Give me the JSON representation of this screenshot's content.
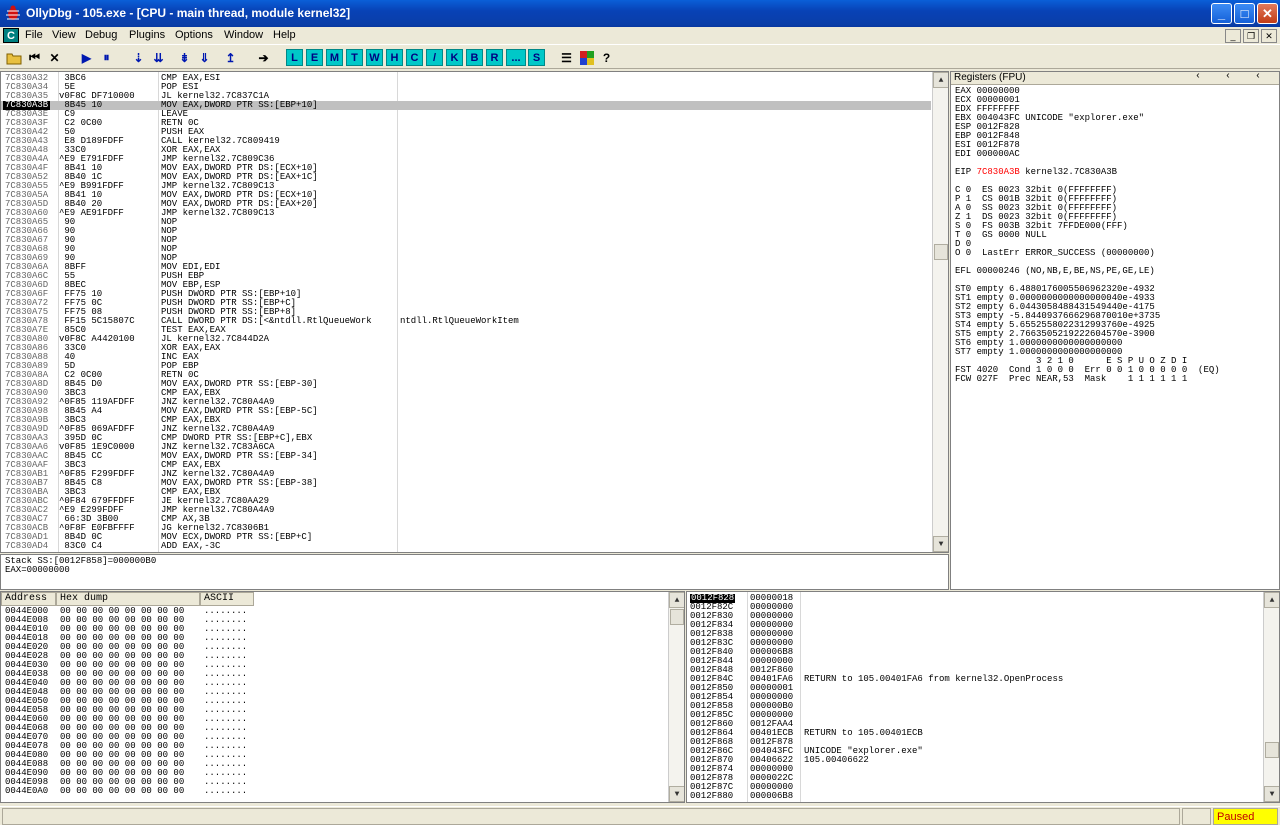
{
  "window": {
    "title": "OllyDbg - 105.exe - [CPU - main thread, module kernel32]",
    "minimize": "_",
    "maximize": "□",
    "close": "✕"
  },
  "menu": {
    "items": [
      "File",
      "View",
      "Debug",
      "Plugins",
      "Options",
      "Window",
      "Help"
    ],
    "c_icon": "C"
  },
  "toolbar": {
    "letters": [
      "L",
      "E",
      "M",
      "T",
      "W",
      "H",
      "C",
      "/",
      "K",
      "B",
      "R",
      "...",
      "S"
    ]
  },
  "disasm": {
    "rows": [
      [
        "7C830A32",
        " 3BC6",
        "CMP EAX,ESI",
        ""
      ],
      [
        "7C830A34",
        " 5E",
        "POP ESI",
        ""
      ],
      [
        "7C830A35",
        "v0F8C DF710000",
        "JL kernel32.7C837C1A",
        ""
      ],
      [
        "7C830A3B",
        " 8B45 10",
        "MOV EAX,DWORD PTR SS:[EBP+10]",
        ""
      ],
      [
        "7C830A3E",
        " C9",
        "LEAVE",
        ""
      ],
      [
        "7C830A3F",
        " C2 0C00",
        "RETN 0C",
        ""
      ],
      [
        "7C830A42",
        " 50",
        "PUSH EAX",
        ""
      ],
      [
        "7C830A43",
        " E8 D189FDFF",
        "CALL kernel32.7C809419",
        ""
      ],
      [
        "7C830A48",
        " 33C0",
        "XOR EAX,EAX",
        ""
      ],
      [
        "7C830A4A",
        "^E9 E791FDFF",
        "JMP kernel32.7C809C36",
        ""
      ],
      [
        "7C830A4F",
        " 8B41 10",
        "MOV EAX,DWORD PTR DS:[ECX+10]",
        ""
      ],
      [
        "7C830A52",
        " 8B40 1C",
        "MOV EAX,DWORD PTR DS:[EAX+1C]",
        ""
      ],
      [
        "7C830A55",
        "^E9 B991FDFF",
        "JMP kernel32.7C809C13",
        ""
      ],
      [
        "7C830A5A",
        " 8B41 10",
        "MOV EAX,DWORD PTR DS:[ECX+10]",
        ""
      ],
      [
        "7C830A5D",
        " 8B40 20",
        "MOV EAX,DWORD PTR DS:[EAX+20]",
        ""
      ],
      [
        "7C830A60",
        "^E9 AE91FDFF",
        "JMP kernel32.7C809C13",
        ""
      ],
      [
        "7C830A65",
        " 90",
        "NOP",
        ""
      ],
      [
        "7C830A66",
        " 90",
        "NOP",
        ""
      ],
      [
        "7C830A67",
        " 90",
        "NOP",
        ""
      ],
      [
        "7C830A68",
        " 90",
        "NOP",
        ""
      ],
      [
        "7C830A69",
        " 90",
        "NOP",
        ""
      ],
      [
        "7C830A6A",
        " 8BFF",
        "MOV EDI,EDI",
        ""
      ],
      [
        "7C830A6C",
        " 55",
        "PUSH EBP",
        ""
      ],
      [
        "7C830A6D",
        " 8BEC",
        "MOV EBP,ESP",
        ""
      ],
      [
        "7C830A6F",
        " FF75 10",
        "PUSH DWORD PTR SS:[EBP+10]",
        ""
      ],
      [
        "7C830A72",
        " FF75 0C",
        "PUSH DWORD PTR SS:[EBP+C]",
        ""
      ],
      [
        "7C830A75",
        " FF75 08",
        "PUSH DWORD PTR SS:[EBP+8]",
        ""
      ],
      [
        "7C830A78",
        " FF15 5C15807C",
        "CALL DWORD PTR DS:[<&ntdll.RtlQueueWork",
        "ntdll.RtlQueueWorkItem"
      ],
      [
        "7C830A7E",
        " 85C0",
        "TEST EAX,EAX",
        ""
      ],
      [
        "7C830A80",
        "v0F8C A4420100",
        "JL kernel32.7C844D2A",
        ""
      ],
      [
        "7C830A86",
        " 33C0",
        "XOR EAX,EAX",
        ""
      ],
      [
        "7C830A88",
        " 40",
        "INC EAX",
        ""
      ],
      [
        "7C830A89",
        " 5D",
        "POP EBP",
        ""
      ],
      [
        "7C830A8A",
        " C2 0C00",
        "RETN 0C",
        ""
      ],
      [
        "7C830A8D",
        " 8B45 D0",
        "MOV EAX,DWORD PTR SS:[EBP-30]",
        ""
      ],
      [
        "7C830A90",
        " 3BC3",
        "CMP EAX,EBX",
        ""
      ],
      [
        "7C830A92",
        "^0F85 119AFDFF",
        "JNZ kernel32.7C80A4A9",
        ""
      ],
      [
        "7C830A98",
        " 8B45 A4",
        "MOV EAX,DWORD PTR SS:[EBP-5C]",
        ""
      ],
      [
        "7C830A9B",
        " 3BC3",
        "CMP EAX,EBX",
        ""
      ],
      [
        "7C830A9D",
        "^0F85 069AFDFF",
        "JNZ kernel32.7C80A4A9",
        ""
      ],
      [
        "7C830AA3",
        " 395D 0C",
        "CMP DWORD PTR SS:[EBP+C],EBX",
        ""
      ],
      [
        "7C830AA6",
        "v0F85 1E9C0000",
        "JNZ kernel32.7C83A6CA",
        ""
      ],
      [
        "7C830AAC",
        " 8B45 CC",
        "MOV EAX,DWORD PTR SS:[EBP-34]",
        ""
      ],
      [
        "7C830AAF",
        " 3BC3",
        "CMP EAX,EBX",
        ""
      ],
      [
        "7C830AB1",
        "^0F85 F299FDFF",
        "JNZ kernel32.7C80A4A9",
        ""
      ],
      [
        "7C830AB7",
        " 8B45 C8",
        "MOV EAX,DWORD PTR SS:[EBP-38]",
        ""
      ],
      [
        "7C830ABA",
        " 3BC3",
        "CMP EAX,EBX",
        ""
      ],
      [
        "7C830ABC",
        "^0F84 679FFDFF",
        "JE kernel32.7C80AA29",
        ""
      ],
      [
        "7C830AC2",
        "^E9 E299FDFF",
        "JMP kernel32.7C80A4A9",
        ""
      ],
      [
        "7C830AC7",
        " 66:3D 3B00",
        "CMP AX,3B",
        ""
      ],
      [
        "7C830ACB",
        "^0F8F E0FBFFFF",
        "JG kernel32.7C8306B1",
        ""
      ],
      [
        "7C830AD1",
        " 8B4D 0C",
        "MOV ECX,DWORD PTR SS:[EBP+C]",
        ""
      ],
      [
        "7C830AD4",
        " 83C0 C4",
        "ADD EAX,-3C",
        ""
      ]
    ]
  },
  "info": {
    "line1": "Stack SS:[0012F858]=000000B0",
    "line2": "EAX=00000000"
  },
  "registers": {
    "title": "Registers (FPU)",
    "lines": [
      "EAX 00000000",
      "ECX 00000001",
      "EDX FFFFFFFF",
      "EBX 004043FC UNICODE \"explorer.exe\"",
      "ESP 0012F828",
      "EBP 0012F848",
      "ESI 0012F878",
      "EDI 000000AC",
      "",
      "EIP|7C830A3B| kernel32.7C830A3B",
      "",
      "C 0  ES 0023 32bit 0(FFFFFFFF)",
      "P 1  CS 001B 32bit 0(FFFFFFFF)",
      "A 0  SS 0023 32bit 0(FFFFFFFF)",
      "Z 1  DS 0023 32bit 0(FFFFFFFF)",
      "S 0  FS 003B 32bit 7FFDE000(FFF)",
      "T 0  GS 0000 NULL",
      "D 0",
      "O 0  LastErr ERROR_SUCCESS (00000000)",
      "",
      "EFL 00000246 (NO,NB,E,BE,NS,PE,GE,LE)",
      "",
      "ST0 empty 6.4880176005506962320e-4932",
      "ST1 empty 0.0000000000000000040e-4933",
      "ST2 empty 6.0443058488431549440e-4175",
      "ST3 empty -5.8440937666296870010e+3735",
      "ST4 empty 5.6552558022312993760e-4925",
      "ST5 empty 2.7663505219222604570e-3900",
      "ST6 empty 1.0000000000000000000",
      "ST7 empty 1.0000000000000000000",
      "               3 2 1 0      E S P U O Z D I",
      "FST 4020  Cond 1 0 0 0  Err 0 0 1 0 0 0 0 0  (EQ)",
      "FCW 027F  Prec NEAR,53  Mask    1 1 1 1 1 1"
    ]
  },
  "dump": {
    "headers": [
      "Address",
      "Hex dump",
      "ASCII"
    ],
    "hex": "00 00 00 00 00 00 00 00",
    "ascii": "........",
    "addresses": [
      "0044E000",
      "0044E008",
      "0044E010",
      "0044E018",
      "0044E020",
      "0044E028",
      "0044E030",
      "0044E038",
      "0044E040",
      "0044E048",
      "0044E050",
      "0044E058",
      "0044E060",
      "0044E068",
      "0044E070",
      "0044E078",
      "0044E080",
      "0044E088",
      "0044E090",
      "0044E098",
      "0044E0A0"
    ]
  },
  "stack": {
    "rows": [
      [
        "0012F828",
        "00000018",
        ""
      ],
      [
        "0012F82C",
        "00000000",
        ""
      ],
      [
        "0012F830",
        "00000000",
        ""
      ],
      [
        "0012F834",
        "00000000",
        ""
      ],
      [
        "0012F838",
        "00000000",
        ""
      ],
      [
        "0012F83C",
        "00000000",
        ""
      ],
      [
        "0012F840",
        "000006B8",
        ""
      ],
      [
        "0012F844",
        "00000000",
        ""
      ],
      [
        "0012F848",
        "0012F860",
        ""
      ],
      [
        "0012F84C",
        "00401FA6",
        "RETURN to 105.00401FA6 from kernel32.OpenProcess"
      ],
      [
        "0012F850",
        "00000001",
        ""
      ],
      [
        "0012F854",
        "00000000",
        ""
      ],
      [
        "0012F858",
        "000000B0",
        ""
      ],
      [
        "0012F85C",
        "00000000",
        ""
      ],
      [
        "0012F860",
        "0012FAA4",
        ""
      ],
      [
        "0012F864",
        "00401ECB",
        "RETURN to 105.00401ECB"
      ],
      [
        "0012F868",
        "0012F878",
        ""
      ],
      [
        "0012F86C",
        "004043FC",
        "UNICODE \"explorer.exe\""
      ],
      [
        "0012F870",
        "00406622",
        "105.00406622"
      ],
      [
        "0012F874",
        "00000000",
        ""
      ],
      [
        "0012F878",
        "0000022C",
        ""
      ],
      [
        "0012F87C",
        "00000000",
        ""
      ],
      [
        "0012F880",
        "000006B8",
        ""
      ]
    ]
  },
  "status": {
    "state": "Paused"
  }
}
